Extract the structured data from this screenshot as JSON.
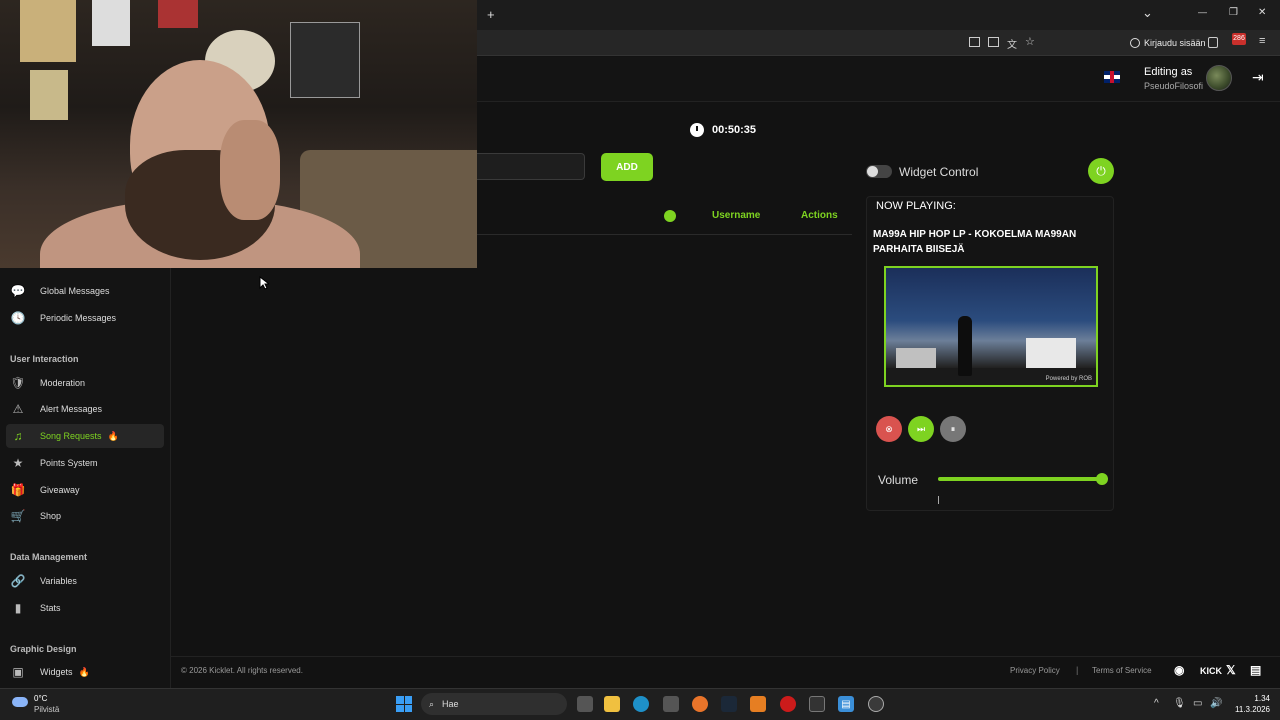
{
  "browser": {
    "new_tab_icon": "+",
    "chevron_icon": "⌄",
    "minimize_icon": "—",
    "restore_icon": "❐",
    "close_icon": "✕",
    "signin_label": "Kirjaudu sisään",
    "extension_badge": "286",
    "menu_icon": "≡"
  },
  "header": {
    "editing_as": "Editing as",
    "username": "PseudoFilosofi",
    "logout_icon": "⇥"
  },
  "sidebar": {
    "items_top": [
      {
        "label": "Global Messages",
        "icon": "💬"
      },
      {
        "label": "Periodic Messages",
        "icon": "🕓"
      }
    ],
    "section_user_interaction": "User Interaction",
    "items_user": [
      {
        "label": "Moderation",
        "icon": "🛡"
      },
      {
        "label": "Alert Messages",
        "icon": "⚠"
      },
      {
        "label": "Song Requests",
        "icon": "♫",
        "fire": "🔥"
      },
      {
        "label": "Points System",
        "icon": "★"
      },
      {
        "label": "Giveaway",
        "icon": "🎁"
      },
      {
        "label": "Shop",
        "icon": "🛒"
      }
    ],
    "section_data_management": "Data Management",
    "items_data": [
      {
        "label": "Variables",
        "icon": "🔗"
      },
      {
        "label": "Stats",
        "icon": "▮"
      }
    ],
    "section_graphic_design": "Graphic Design",
    "items_graphic": [
      {
        "label": "Widgets",
        "icon": "▣",
        "fire": "🔥"
      }
    ]
  },
  "main": {
    "timer": "00:50:35",
    "add_button": "ADD",
    "columns": {
      "username": "Username",
      "actions": "Actions"
    }
  },
  "widget": {
    "label": "Widget Control",
    "power_icon": "⏻",
    "now_playing_label": "NOW PLAYING:",
    "title": "MA99A HIP HOP LP - KOKOELMA MA99AN PARHAITA BIISEJÄ",
    "thumbnail_watermark": "Powered by ROB",
    "remove_icon": "⊗",
    "skip_icon": "⏭",
    "pause_icon": "⏸",
    "volume_label": "Volume",
    "volume_level": 1.0
  },
  "footer": {
    "copyright": "© 2026 Kicklet. All rights reserved.",
    "privacy": "Privacy Policy",
    "separator": "|",
    "terms": "Terms of Service",
    "kick": "KICK",
    "x_icon": "𝕏",
    "doc_icon": "▤",
    "discord_icon": "◉"
  },
  "taskbar": {
    "weather_temp": "0°C",
    "weather_desc": "Pilvistä",
    "search_placeholder": "Hae",
    "search_icon": "⌕",
    "time": "1.34",
    "date": "11.3.2026",
    "tray_arrow": "^",
    "mic_icon": "🎙",
    "wifi_icon": "▭",
    "speaker_icon": "🔊",
    "notes_icon": "▤"
  },
  "colors": {
    "accent": "#7ed321",
    "danger": "#d9534f",
    "background": "#121212"
  }
}
